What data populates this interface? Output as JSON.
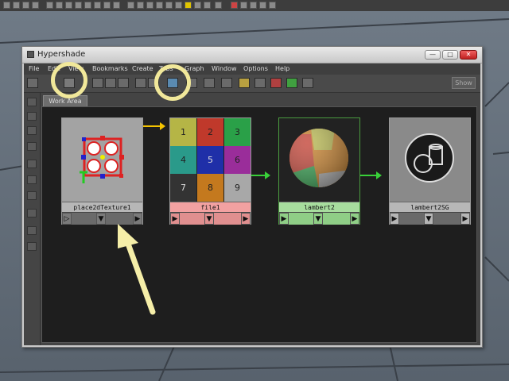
{
  "window": {
    "title": "Hypershade"
  },
  "menu": [
    "File",
    "Edit",
    "View",
    "Bookmarks",
    "Create",
    "Tabs",
    "Graph",
    "Window",
    "Options",
    "Help"
  ],
  "toolbar": {
    "show_label": "Show"
  },
  "tabs": [
    {
      "label": "Work Area"
    }
  ],
  "nodes": [
    {
      "label": "place2dTexture1",
      "kind": "place2d"
    },
    {
      "label": "file1",
      "kind": "file"
    },
    {
      "label": "lambert2",
      "kind": "lambert"
    },
    {
      "label": "lambert2SG",
      "kind": "shading-group"
    }
  ],
  "file_grid": [
    "1",
    "2",
    "3",
    "4",
    "5",
    "6",
    "7",
    "8",
    "9"
  ],
  "colors": {
    "highlight": "#f1e89a",
    "connection_out": "#f5c400",
    "connection_green": "#39d039",
    "file_label": "#f2a1a1",
    "lambert_label": "#a7dd9e"
  }
}
